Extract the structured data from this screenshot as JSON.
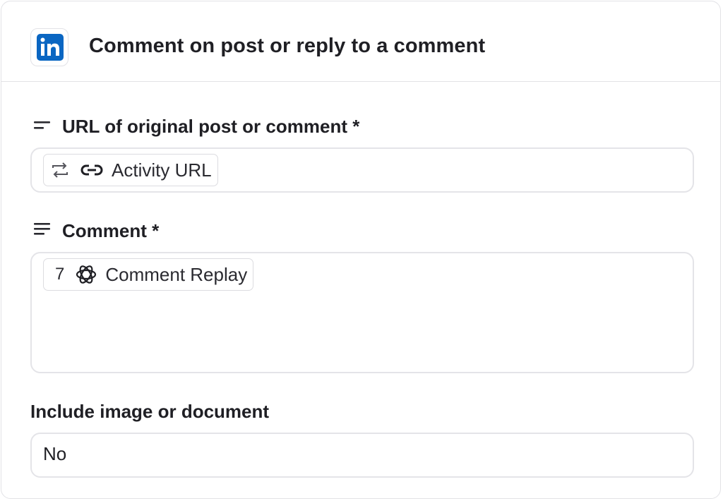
{
  "header": {
    "app_icon": "linkedin-icon",
    "logo_text": "in",
    "title": "Comment on post or reply to a comment"
  },
  "fields": {
    "url": {
      "label_icon": "short-text-icon",
      "label": "URL of original post or comment *",
      "token": {
        "step_icon": "loop-icon",
        "type_icon": "link-icon",
        "text": "Activity URL"
      }
    },
    "comment": {
      "label_icon": "long-text-icon",
      "label": "Comment *",
      "token": {
        "step_number": "7",
        "app_icon": "openai-icon",
        "text": "Comment Replay"
      }
    },
    "include_media": {
      "label": "Include image or document",
      "value": "No"
    }
  },
  "colors": {
    "linkedin_blue": "#0a66c2",
    "border": "#e2e2e6",
    "text": "#1f1f24"
  }
}
